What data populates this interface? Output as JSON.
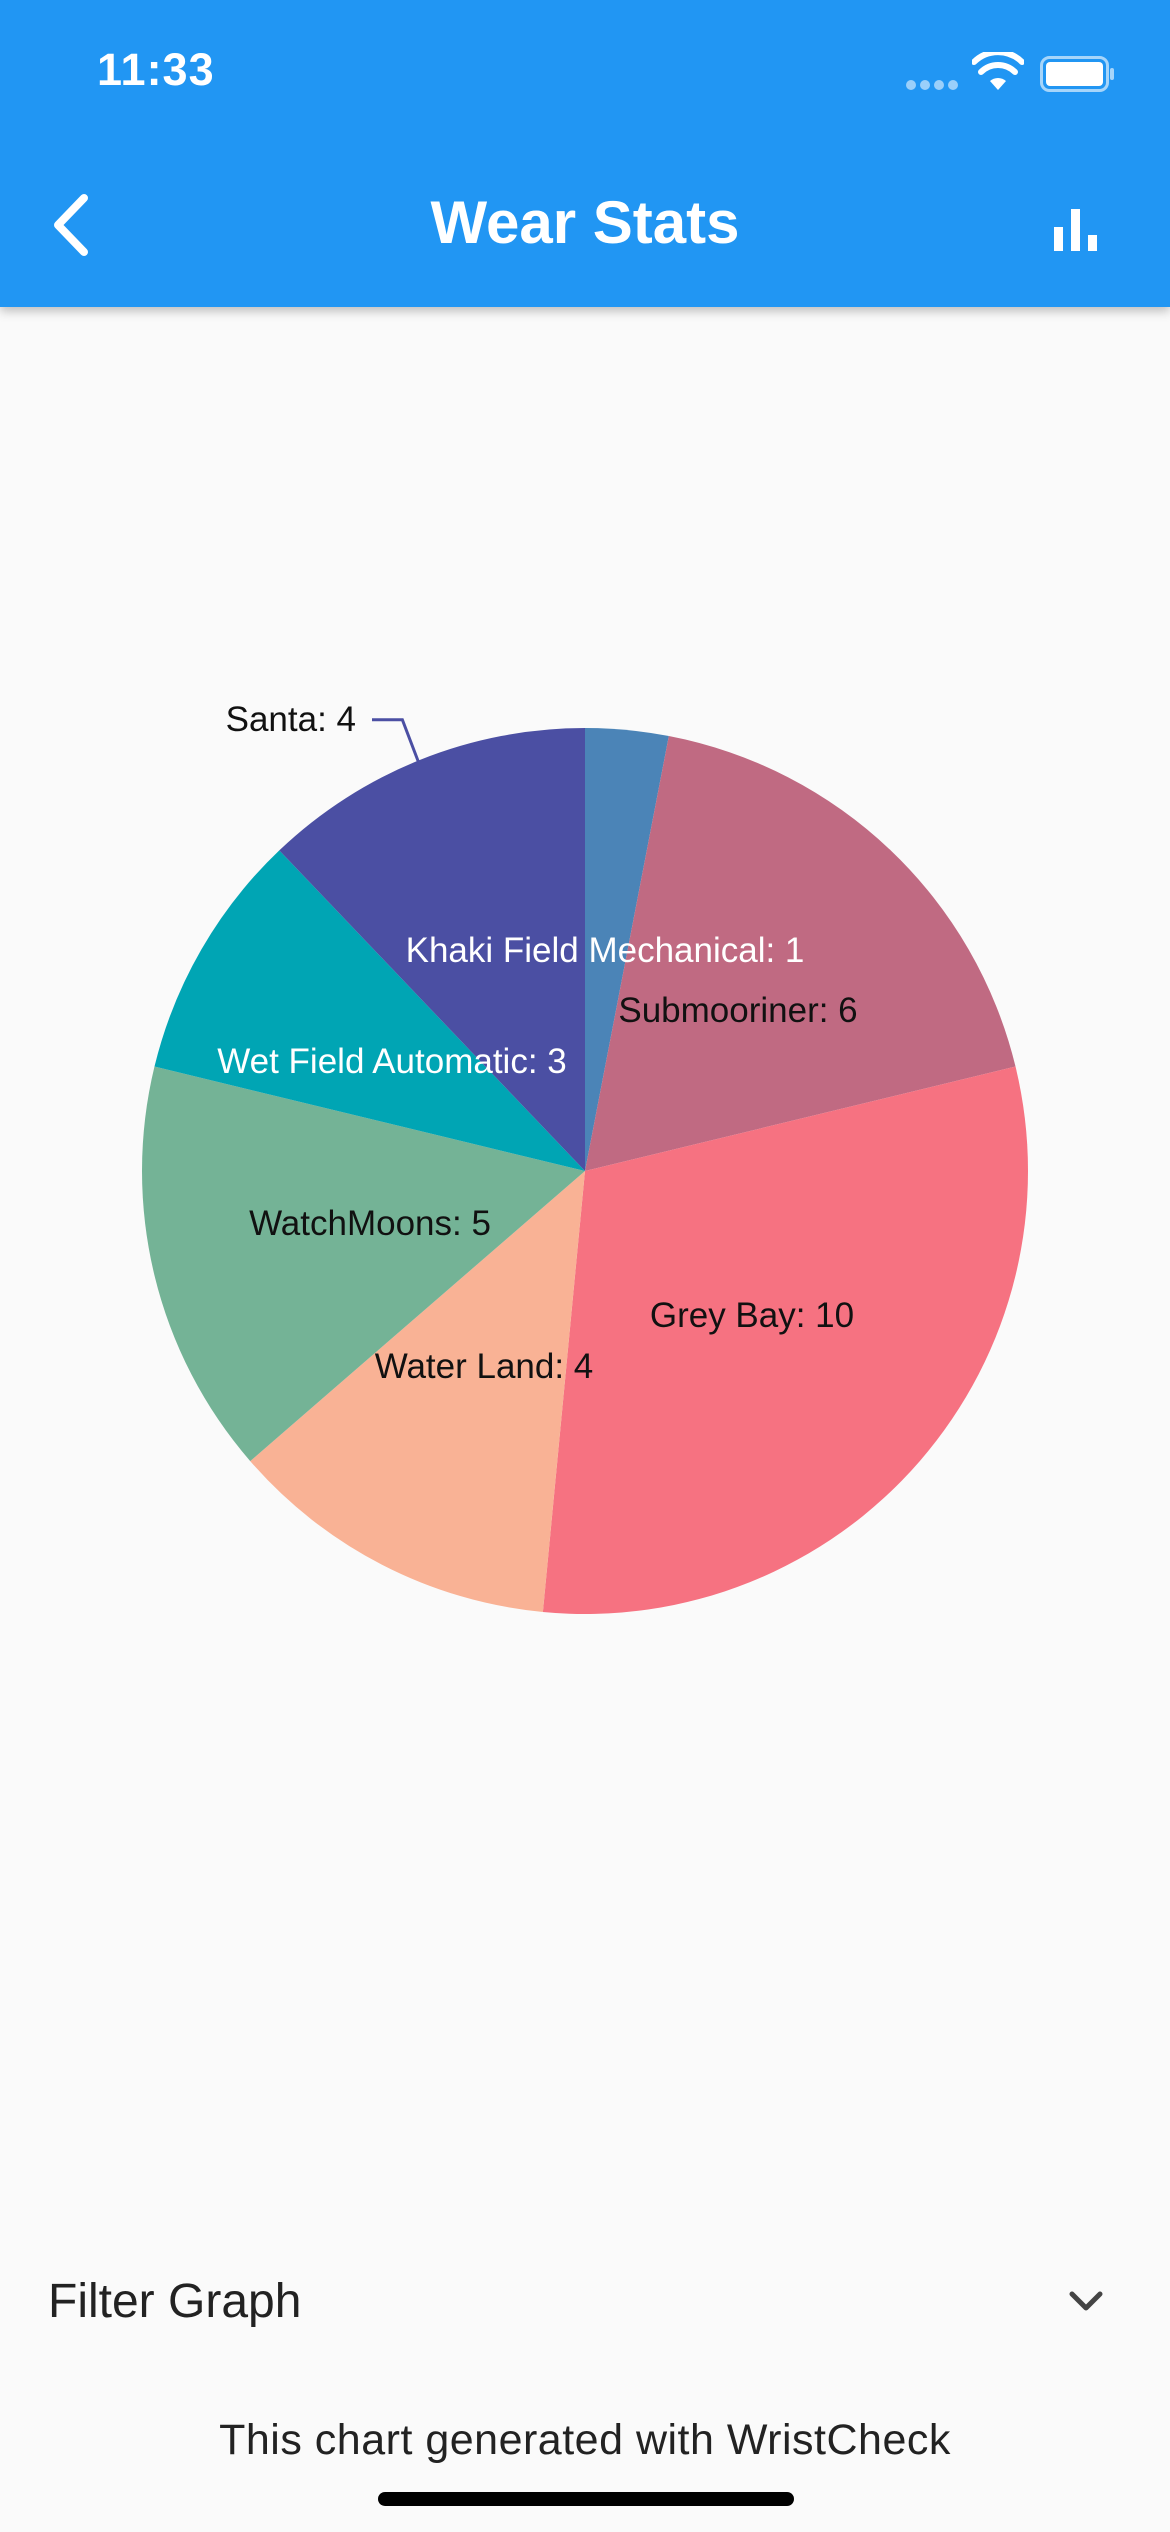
{
  "status_bar": {
    "time": "11:33",
    "signal_icon": "signal-dots-icon",
    "wifi_icon": "wifi-icon",
    "battery_icon": "battery-icon"
  },
  "app_bar": {
    "title": "Wear Stats",
    "back_icon": "chevron-left-icon",
    "action_icon": "bar-chart-icon",
    "background_color": "#2196f3"
  },
  "chart_data": {
    "type": "pie",
    "start": "12 o'clock, clockwise",
    "slices": [
      {
        "label": "Khaki Field Mechanical",
        "value": 1,
        "display": "Khaki Field Mechanical: 1",
        "color": "#4b84b7",
        "text_color": "#ffffff"
      },
      {
        "label": "Submooriner",
        "value": 6,
        "display": "Submooriner: 6",
        "color": "#c06a82",
        "text_color": "#111111"
      },
      {
        "label": "Grey Bay",
        "value": 10,
        "display": "Grey Bay: 10",
        "color": "#f67281",
        "text_color": "#111111"
      },
      {
        "label": "Water Land",
        "value": 4,
        "display": "Water Land: 4",
        "color": "#f9b295",
        "text_color": "#111111"
      },
      {
        "label": "WatchMoons",
        "value": 5,
        "display": "WatchMoons: 5",
        "color": "#74b396",
        "text_color": "#111111"
      },
      {
        "label": "Wet Field Automatic",
        "value": 3,
        "display": "Wet Field Automatic: 3",
        "color": "#00a5b4",
        "text_color": "#ffffff"
      },
      {
        "label": "Santa",
        "value": 4,
        "display": "Santa: 4",
        "color": "#4b4fa3",
        "text_color": "#111111"
      }
    ]
  },
  "filter": {
    "label": "Filter Graph",
    "chevron_icon": "chevron-down-icon"
  },
  "footer": {
    "note": "This chart generated with WristCheck"
  }
}
